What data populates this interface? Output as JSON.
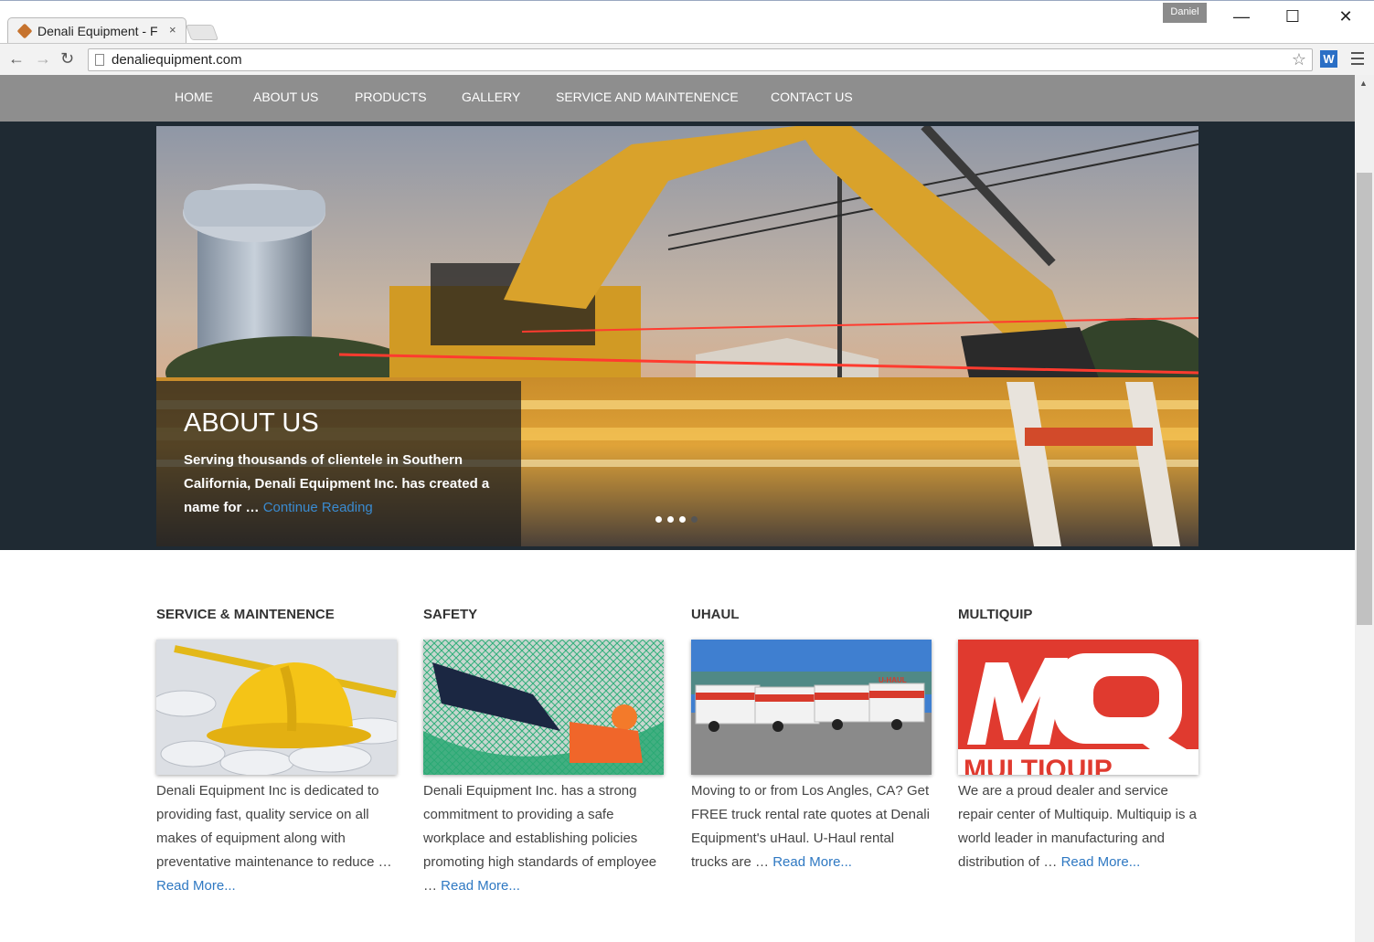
{
  "browser": {
    "tab_title": "Denali Equipment - F",
    "tab_close": "×",
    "profile_name": "Daniel",
    "minimize": "—",
    "maximize": "☐",
    "close": "✕",
    "back": "←",
    "forward": "→",
    "reload": "↻",
    "url": "denaliequipment.com",
    "bookmark_star": "☆",
    "extension_label": "W"
  },
  "nav": {
    "items": [
      {
        "label": "HOME"
      },
      {
        "label": "ABOUT US"
      },
      {
        "label": "PRODUCTS"
      },
      {
        "label": "GALLERY"
      },
      {
        "label": "SERVICE AND MAINTENENCE"
      },
      {
        "label": "CONTACT US"
      }
    ]
  },
  "hero": {
    "title": "ABOUT US",
    "text": "Serving thousands of clientele in Southern California, Denali Equipment Inc. has created a name for …",
    "link": "Continue Reading",
    "slides": 4,
    "active_slide": 1
  },
  "cards": [
    {
      "title": "SERVICE & MAINTENENCE",
      "text": "Denali Equipment Inc is dedicated to providing fast, quality service on all makes of equipment along with preventative maintenance to reduce …",
      "link": "Read More..."
    },
    {
      "title": "SAFETY",
      "text": "Denali Equipment Inc. has a strong commitment to providing a safe workplace and establishing policies promoting high standards of employee …",
      "link": "Read More..."
    },
    {
      "title": "UHAUL",
      "text": "Moving to or from Los Angles, CA? Get FREE truck rental rate quotes at Denali Equipment's uHaul. U-Haul rental trucks are …",
      "link": "Read More...",
      "image_text": "U-HAUL"
    },
    {
      "title": "MULTIQUIP",
      "text": "We are a proud dealer and service repair center of Multiquip. Multiquip is a world leader in manufacturing and distribution of …",
      "link": "Read More...",
      "image_text": "MULTIQUIP"
    }
  ],
  "colors": {
    "nav_bg": "#8e8e8e",
    "hero_band": "#1f2a33",
    "link": "#2e78c2",
    "multiquip_red": "#e03a2f"
  }
}
